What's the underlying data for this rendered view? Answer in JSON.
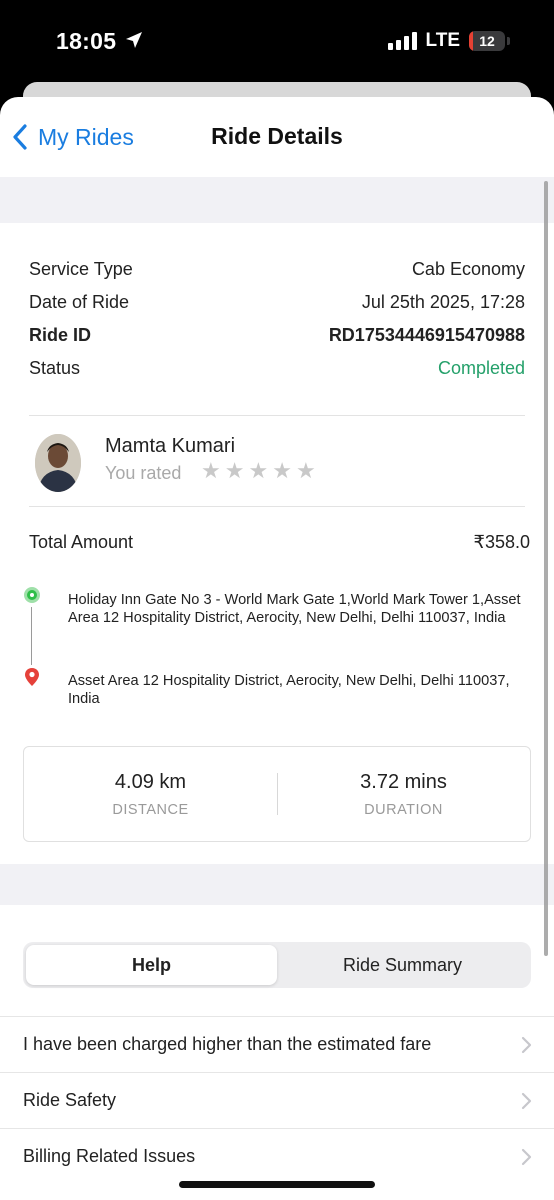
{
  "status_bar": {
    "time": "18:05",
    "network": "LTE",
    "battery": "12",
    "battery_level": 0.12
  },
  "nav": {
    "back_label": "My Rides",
    "title": "Ride Details"
  },
  "details": [
    {
      "label": "Service Type",
      "value": "Cab Economy"
    },
    {
      "label": "Date of Ride",
      "value": "Jul 25th 2025, 17:28"
    },
    {
      "label": "Ride ID",
      "value": "RD17534446915470988"
    },
    {
      "label": "Status",
      "value": "Completed"
    }
  ],
  "driver": {
    "name": "Mamta Kumari",
    "rated_label": "You rated",
    "rating": 0,
    "max_rating": 5
  },
  "total": {
    "label": "Total Amount",
    "value": "₹358.0"
  },
  "route": {
    "pickup": "Holiday Inn Gate No 3 - World Mark Gate 1,World Mark Tower 1,Asset Area 12 Hospitality District, Aerocity, New Delhi, Delhi 110037, India",
    "drop": "Asset Area 12 Hospitality District, Aerocity, New Delhi, Delhi 110037, India"
  },
  "stats": {
    "distance_value": "4.09 km",
    "distance_label": "DISTANCE",
    "duration_value": "3.72 mins",
    "duration_label": "DURATION"
  },
  "tabs": [
    {
      "label": "Help",
      "active": true
    },
    {
      "label": "Ride Summary",
      "active": false
    }
  ],
  "help_items": [
    "I have been charged higher than the estimated fare",
    "Ride Safety",
    "Billing Related Issues"
  ],
  "colors": {
    "accent": "#1a7de0",
    "status_completed": "#24a06a",
    "pickup": "#2fbf49",
    "drop": "#e5413a"
  }
}
